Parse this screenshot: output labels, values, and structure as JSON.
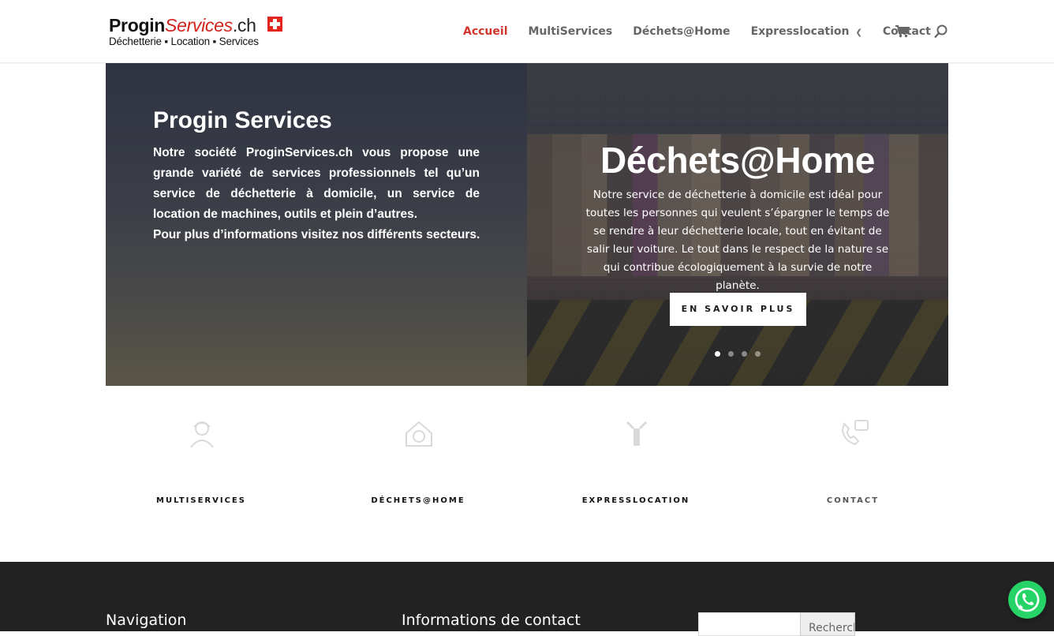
{
  "header": {
    "logo": {
      "brand_bold": "Progin",
      "brand_italic": "Services",
      "brand_tld": ".ch",
      "tagline": "Déchetterie ▪ Location ▪ Services"
    },
    "nav": [
      {
        "label": "Accueil",
        "active": true
      },
      {
        "label": "MultiServices",
        "active": false
      },
      {
        "label": "Déchets@Home",
        "active": false
      },
      {
        "label": "Expresslocation",
        "active": false,
        "dropdown": true
      },
      {
        "label": "Contact",
        "active": false
      }
    ],
    "cart_icon": "cart-icon",
    "search_icon": "search-icon",
    "accent_color": "#d0342c"
  },
  "hero": {
    "left": {
      "title": "Progin Services",
      "text": "Notre société ProginServices.ch vous propose une grande variété de services professionnels tel qu’un service de déchetterie à domicile, un service de location de machines, outils et plein d’autres.",
      "text2": "Pour plus d’informations visitez nos différents secteurs."
    },
    "slide": {
      "title": "Déchets@Home",
      "text": "Notre service de déchetterie à domicile est idéal pour toutes les personnes qui veulent s’épargner le temps de se rendre à leur déchetterie locale, tout en évitant de salir leur voiture. Le tout dans le respect de la nature se qui contribue écologiquement à la survie de notre planète.",
      "button": "EN SAVOIR PLUS",
      "dots_count": 4,
      "active_dot": 1
    }
  },
  "tiles": [
    {
      "label": "MULTISERVICES",
      "icon": "worker-icon"
    },
    {
      "label": "DÉCHETS@HOME",
      "icon": "recycle-house-icon"
    },
    {
      "label": "EXPRESSLOCATION",
      "icon": "tools-icon"
    },
    {
      "label": "CONTACT",
      "icon": "phone-chat-icon"
    }
  ],
  "footer": {
    "nav_heading": "Navigation",
    "contact_heading": "Informations de contact",
    "search_button": "Rechercher",
    "search_value": ""
  },
  "whatsapp_icon": "whatsapp-icon"
}
